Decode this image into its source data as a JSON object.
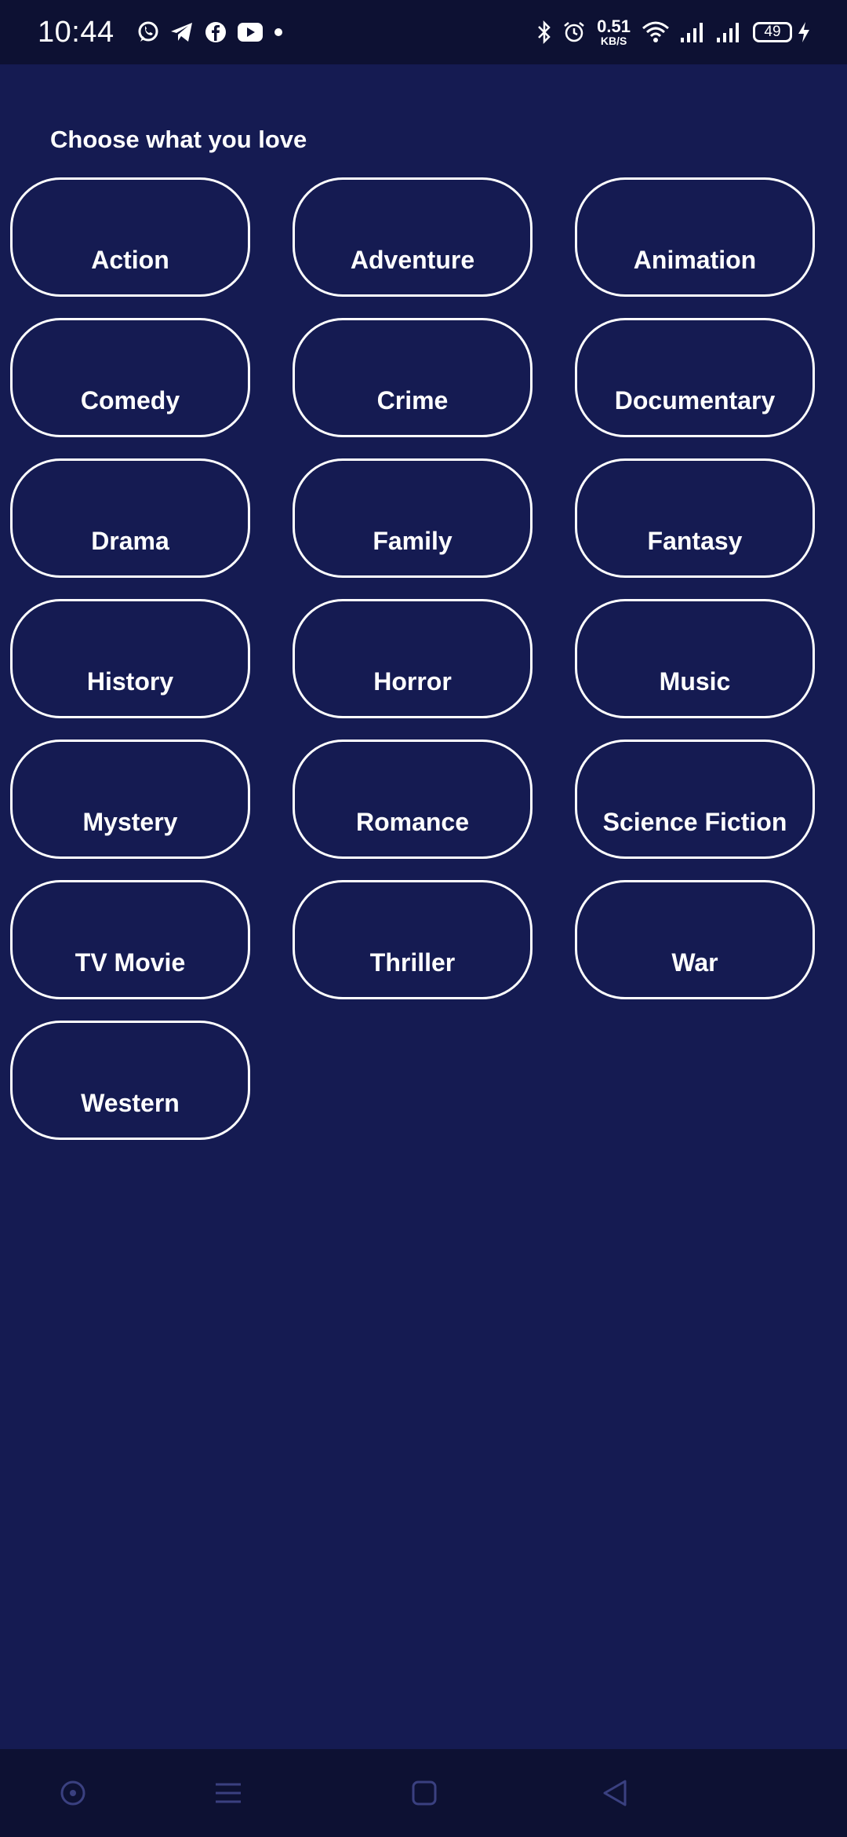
{
  "status_bar": {
    "time": "10:44",
    "notification_icons": [
      "whatsapp-icon",
      "telegram-icon",
      "facebook-icon",
      "youtube-icon",
      "dot-icon"
    ],
    "status_icons": [
      "bluetooth-icon",
      "alarm-icon",
      "wifi-icon",
      "signal-icon",
      "signal-icon",
      "battery-icon",
      "charging-icon"
    ],
    "net_speed_value": "0.51",
    "net_speed_unit": "KB/S",
    "battery_level": "49"
  },
  "page": {
    "heading": "Choose what you love",
    "genres": [
      "Action",
      "Adventure",
      "Animation",
      "Comedy",
      "Crime",
      "Documentary",
      "Drama",
      "Family",
      "Fantasy",
      "History",
      "Horror",
      "Music",
      "Mystery",
      "Romance",
      "Science Fiction",
      "TV Movie",
      "Thriller",
      "War",
      "Western"
    ]
  },
  "nav_bar": {
    "buttons": [
      "assistant-icon",
      "menu-icon",
      "home-icon",
      "back-icon"
    ]
  },
  "colors": {
    "background": "#151b52",
    "system_bar": "#0d1133",
    "chip_border": "#ffffff",
    "nav_icon": "#3a4080"
  }
}
